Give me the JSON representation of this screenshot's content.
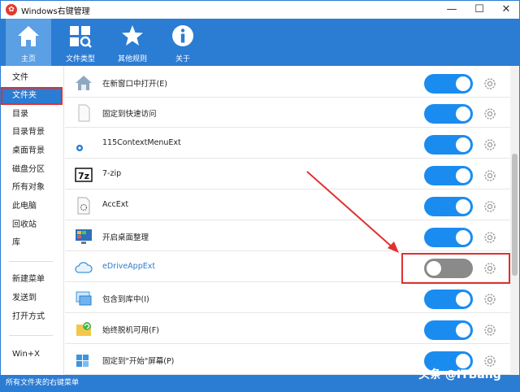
{
  "window": {
    "title": "Windows右键管理",
    "app_icon_glyph": "✿"
  },
  "window_controls": {
    "minimize": "—",
    "maximize": "☐",
    "close": "✕"
  },
  "toolbar": [
    {
      "label": "主页",
      "icon": "home-icon"
    },
    {
      "label": "文件类型",
      "icon": "file-type-icon"
    },
    {
      "label": "其他规则",
      "icon": "star-icon"
    },
    {
      "label": "关于",
      "icon": "info-icon"
    }
  ],
  "sidebar": {
    "items": [
      "文件",
      "文件夹",
      "目录",
      "目录背景",
      "桌面背景",
      "磁盘分区",
      "所有对象",
      "此电脑",
      "回收站",
      "库"
    ],
    "items2": [
      "新建菜单",
      "发送到",
      "打开方式"
    ],
    "items3": [
      "Win+X"
    ],
    "selected": "文件夹"
  },
  "rows": [
    {
      "label": "在新窗口中打开(E)",
      "icon": "house-window-icon",
      "enabled": true
    },
    {
      "label": "固定到快速访问",
      "icon": "blank-file-icon",
      "enabled": true
    },
    {
      "label": "115ContextMenuExt",
      "icon": "115-icon",
      "enabled": true
    },
    {
      "label": "7-zip",
      "icon": "7zip-icon",
      "enabled": true
    },
    {
      "label": "AccExt",
      "icon": "accext-icon",
      "enabled": true
    },
    {
      "label": "开启桌面整理",
      "icon": "desktop-icon",
      "enabled": true
    },
    {
      "label": "eDriveAppExt",
      "icon": "cloud-icon",
      "enabled": false
    },
    {
      "label": "包含到库中(I)",
      "icon": "library-icon",
      "enabled": true
    },
    {
      "label": "始终脱机可用(F)",
      "icon": "offline-folder-icon",
      "enabled": true
    },
    {
      "label": "固定到\"开始\"屏幕(P)",
      "icon": "pin-start-icon",
      "enabled": true
    }
  ],
  "statusbar": {
    "text": "所有文件夹的右键菜单"
  },
  "watermark": "头条 @ITBang",
  "colors": {
    "accent": "#2b7cd3",
    "toggle_on": "#1a8cf0",
    "toggle_off": "#8a8a8a",
    "annotation": "#e03030"
  }
}
